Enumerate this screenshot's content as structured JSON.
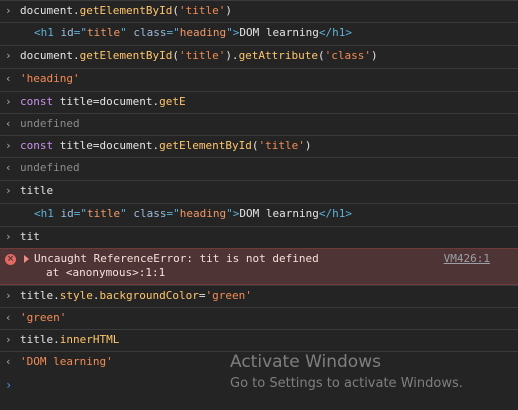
{
  "console": {
    "entries": [
      {
        "type": "input",
        "parts": [
          {
            "t": "document.",
            "c": "plain"
          },
          {
            "t": "getElementById",
            "c": "method"
          },
          {
            "t": "(",
            "c": "plain"
          },
          {
            "t": "'title'",
            "c": "str"
          },
          {
            "t": ")",
            "c": "plain"
          }
        ]
      },
      {
        "type": "output-element",
        "parts": [
          {
            "t": "<h1 ",
            "c": "tag"
          },
          {
            "t": "id",
            "c": "attr"
          },
          {
            "t": "=\"",
            "c": "tag"
          },
          {
            "t": "title",
            "c": "attrval"
          },
          {
            "t": "\" ",
            "c": "tag"
          },
          {
            "t": "class",
            "c": "attr"
          },
          {
            "t": "=\"",
            "c": "tag"
          },
          {
            "t": "heading",
            "c": "attrval"
          },
          {
            "t": "\">",
            "c": "tag"
          },
          {
            "t": "DOM learning",
            "c": "plain"
          },
          {
            "t": "</h1>",
            "c": "tag"
          }
        ]
      },
      {
        "type": "input",
        "parts": [
          {
            "t": "document.",
            "c": "plain"
          },
          {
            "t": "getElementById",
            "c": "method"
          },
          {
            "t": "(",
            "c": "plain"
          },
          {
            "t": "'title'",
            "c": "str"
          },
          {
            "t": ").",
            "c": "plain"
          },
          {
            "t": "getAttribute",
            "c": "method"
          },
          {
            "t": "(",
            "c": "plain"
          },
          {
            "t": "'class'",
            "c": "str"
          },
          {
            "t": ")",
            "c": "plain"
          }
        ]
      },
      {
        "type": "output",
        "parts": [
          {
            "t": "'heading'",
            "c": "result-str"
          }
        ]
      },
      {
        "type": "input",
        "parts": [
          {
            "t": "const ",
            "c": "kw"
          },
          {
            "t": "title",
            "c": "plain"
          },
          {
            "t": "=document.",
            "c": "plain"
          },
          {
            "t": "getE",
            "c": "method"
          }
        ]
      },
      {
        "type": "output",
        "parts": [
          {
            "t": "undefined",
            "c": "undef"
          }
        ]
      },
      {
        "type": "input",
        "parts": [
          {
            "t": "const ",
            "c": "kw"
          },
          {
            "t": "title",
            "c": "plain"
          },
          {
            "t": "=document.",
            "c": "plain"
          },
          {
            "t": "getElementById",
            "c": "method"
          },
          {
            "t": "(",
            "c": "plain"
          },
          {
            "t": "'title'",
            "c": "str"
          },
          {
            "t": ")",
            "c": "plain"
          }
        ]
      },
      {
        "type": "output",
        "parts": [
          {
            "t": "undefined",
            "c": "undef"
          }
        ]
      },
      {
        "type": "input",
        "parts": [
          {
            "t": "title",
            "c": "plain"
          }
        ]
      },
      {
        "type": "output-element",
        "parts": [
          {
            "t": "<h1 ",
            "c": "tag"
          },
          {
            "t": "id",
            "c": "attr"
          },
          {
            "t": "=\"",
            "c": "tag"
          },
          {
            "t": "title",
            "c": "attrval"
          },
          {
            "t": "\" ",
            "c": "tag"
          },
          {
            "t": "class",
            "c": "attr"
          },
          {
            "t": "=\"",
            "c": "tag"
          },
          {
            "t": "heading",
            "c": "attrval"
          },
          {
            "t": "\">",
            "c": "tag"
          },
          {
            "t": "DOM learning",
            "c": "plain"
          },
          {
            "t": "</h1>",
            "c": "tag"
          }
        ]
      },
      {
        "type": "input",
        "parts": [
          {
            "t": "tit",
            "c": "plain"
          }
        ]
      },
      {
        "type": "error",
        "line1": "Uncaught ReferenceError: tit is not defined",
        "line2": "at <anonymous>:1:1",
        "link": "VM426:1"
      },
      {
        "type": "input",
        "parts": [
          {
            "t": "title.",
            "c": "plain"
          },
          {
            "t": "style",
            "c": "method"
          },
          {
            "t": ".",
            "c": "plain"
          },
          {
            "t": "backgroundColor",
            "c": "method"
          },
          {
            "t": "=",
            "c": "plain"
          },
          {
            "t": "'green'",
            "c": "str"
          }
        ]
      },
      {
        "type": "output",
        "parts": [
          {
            "t": "'green'",
            "c": "result-str"
          }
        ]
      },
      {
        "type": "input",
        "parts": [
          {
            "t": "title.",
            "c": "plain"
          },
          {
            "t": "innerHTML",
            "c": "method"
          }
        ]
      },
      {
        "type": "output",
        "parts": [
          {
            "t": "'DOM learning'",
            "c": "result-str"
          }
        ]
      }
    ],
    "prompt_symbol": "›",
    "input_marker": "›",
    "output_marker": "‹"
  },
  "watermark": {
    "title": "Activate Windows",
    "subtitle": "Go to Settings to activate Windows."
  },
  "colors": {
    "background": "#242424",
    "error_background": "#4e3434",
    "string": "#f28b54",
    "method": "#ffc66d",
    "keyword": "#c792ea",
    "tag": "#5db0d7",
    "prompt": "#4a8ee6"
  }
}
